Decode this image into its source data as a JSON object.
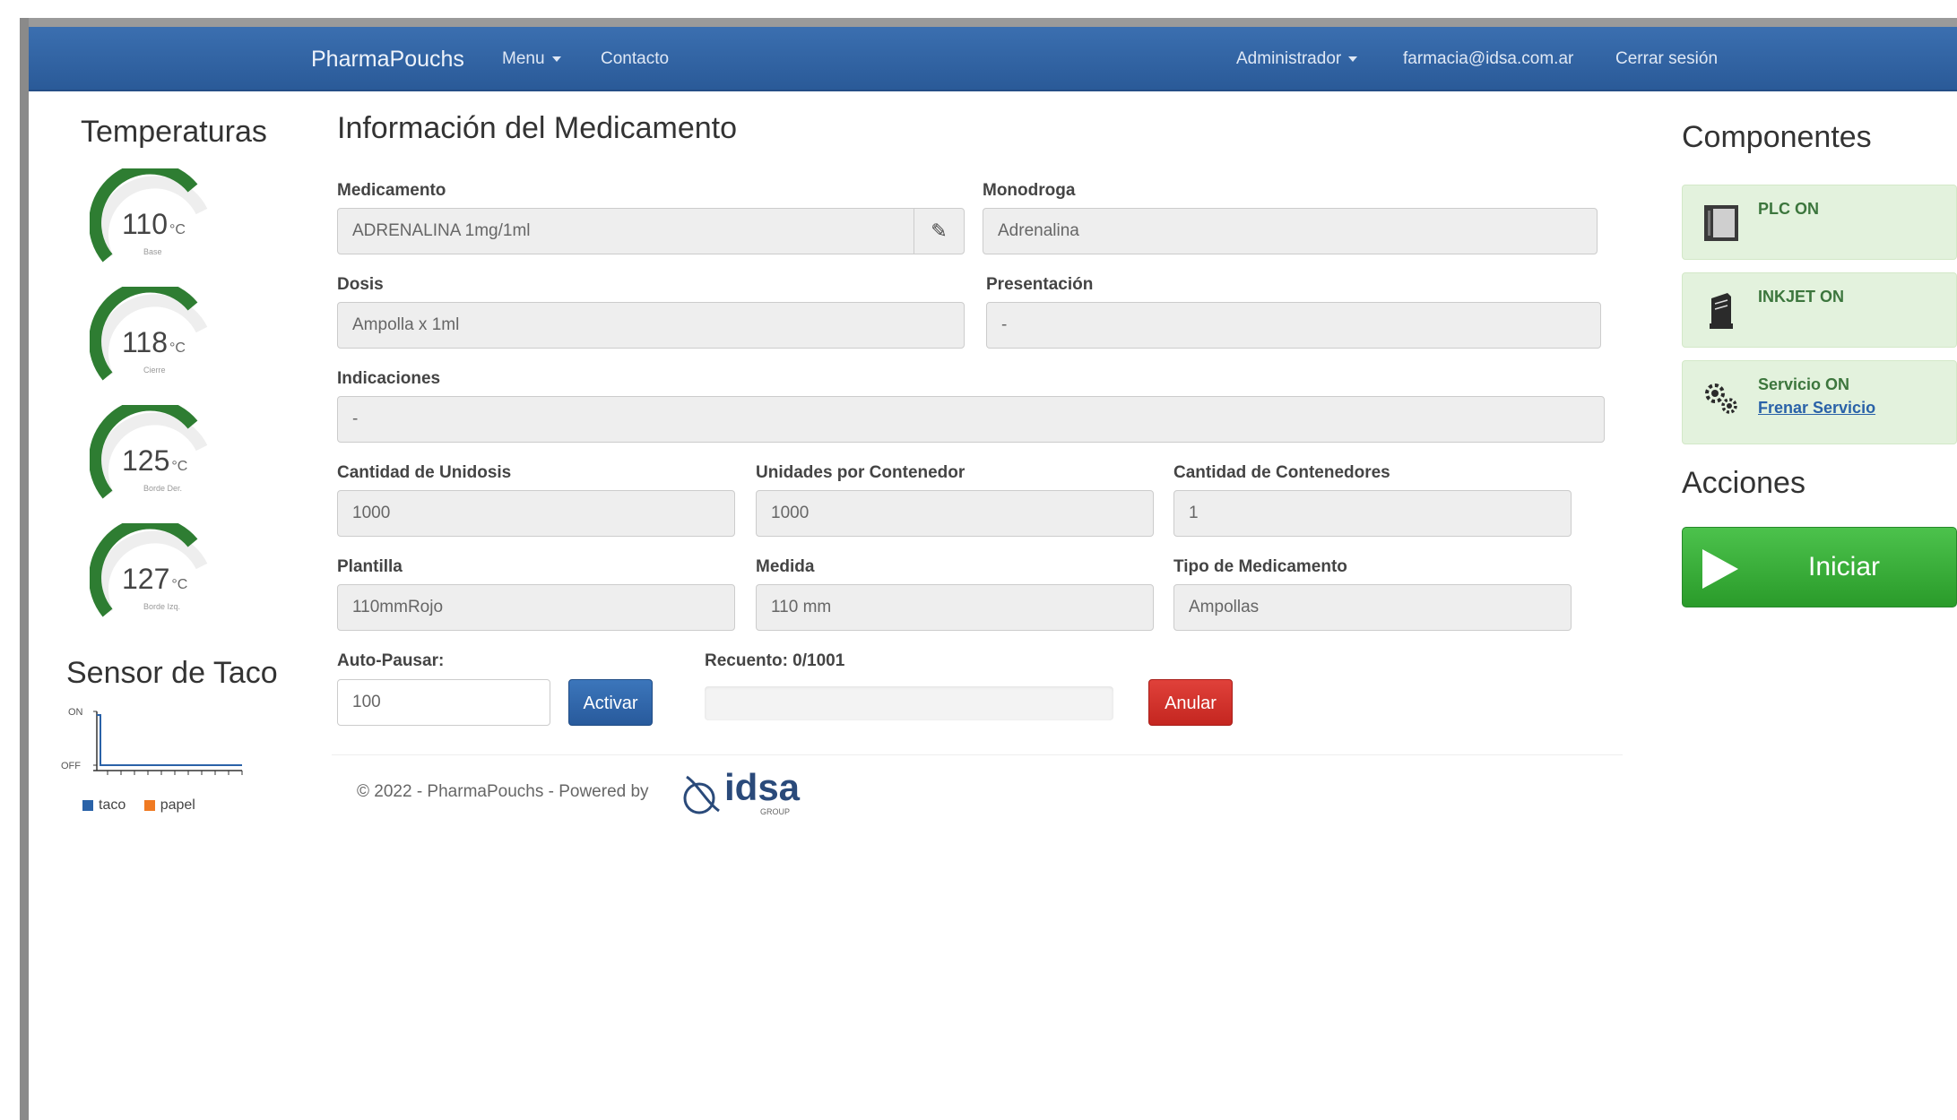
{
  "navbar": {
    "brand": "PharmaPouchs",
    "menu": "Menu",
    "contact": "Contacto",
    "admin": "Administrador",
    "email": "farmacia@idsa.com.ar",
    "logout": "Cerrar sesión"
  },
  "temperatures": {
    "title": "Temperaturas",
    "unit": "°C",
    "gauges": [
      {
        "value": "110",
        "label": "Base"
      },
      {
        "value": "118",
        "label": "Cierre"
      },
      {
        "value": "125",
        "label": "Borde Der."
      },
      {
        "value": "127",
        "label": "Borde Izq."
      }
    ]
  },
  "sensor": {
    "title": "Sensor de Taco",
    "y_on": "ON",
    "y_off": "OFF",
    "legend": [
      {
        "name": "taco",
        "color": "#2a62a8"
      },
      {
        "name": "papel",
        "color": "#f07a22"
      }
    ]
  },
  "form": {
    "title": "Información del Medicamento",
    "medicamento": {
      "label": "Medicamento",
      "value": "ADRENALINA 1mg/1ml"
    },
    "monodroga": {
      "label": "Monodroga",
      "value": "Adrenalina"
    },
    "dosis": {
      "label": "Dosis",
      "value": "Ampolla x 1ml"
    },
    "presentacion": {
      "label": "Presentación",
      "value": "-"
    },
    "indicaciones": {
      "label": "Indicaciones",
      "value": "-"
    },
    "cantidad_unidosis": {
      "label": "Cantidad de Unidosis",
      "value": "1000"
    },
    "unidades_contenedor": {
      "label": "Unidades por Contenedor",
      "value": "1000"
    },
    "cantidad_contenedores": {
      "label": "Cantidad de Contenedores",
      "value": "1"
    },
    "plantilla": {
      "label": "Plantilla",
      "value": "110mmRojo"
    },
    "medida": {
      "label": "Medida",
      "value": "110 mm"
    },
    "tipo": {
      "label": "Tipo de Medicamento",
      "value": "Ampollas"
    },
    "auto_pausar": {
      "label": "Auto-Pausar:",
      "value": "100"
    },
    "activar": "Activar",
    "recuento": {
      "label": "Recuento: 0/1001",
      "progress": 0
    },
    "anular": "Anular"
  },
  "footer": {
    "text": "© 2022 - PharmaPouchs - Powered by",
    "logo_word": "idsa",
    "logo_sub": "GROUP"
  },
  "components": {
    "title": "Componentes",
    "items": [
      {
        "title": "PLC ON",
        "icon": "plc-icon"
      },
      {
        "title": "INKJET ON",
        "icon": "inkjet-icon"
      },
      {
        "title": "Servicio ON",
        "link": "Frenar Servicio",
        "icon": "gears-icon"
      }
    ]
  },
  "actions": {
    "title": "Acciones",
    "start": "Iniciar"
  }
}
